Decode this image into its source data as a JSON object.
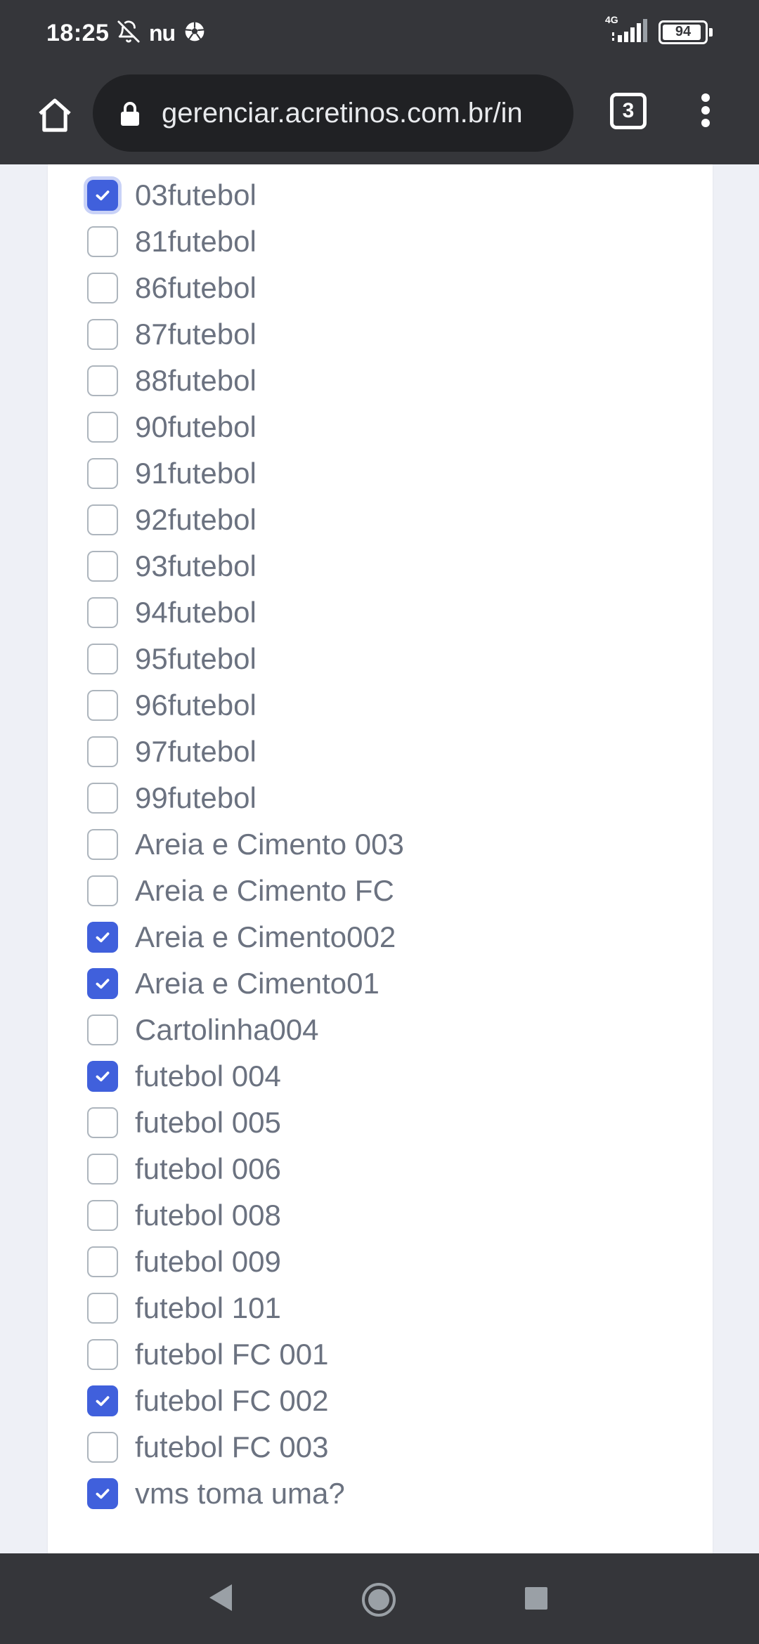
{
  "status_bar": {
    "time": "18:25",
    "notification_app": "nu",
    "network": "4G",
    "battery_percent": "94",
    "battery_level": 0.94,
    "icons": [
      "bell-off-icon",
      "soccer-ball-icon",
      "signal-icon",
      "battery-icon"
    ]
  },
  "browser": {
    "url": "gerenciar.acretinos.com.br/in",
    "tab_count": "3",
    "icons": [
      "home-icon",
      "lock-icon",
      "tab-switcher-icon",
      "more-vert-icon"
    ]
  },
  "options": [
    {
      "label": "03futebol",
      "checked": true,
      "focused": true
    },
    {
      "label": "81futebol",
      "checked": false
    },
    {
      "label": "86futebol",
      "checked": false
    },
    {
      "label": "87futebol",
      "checked": false
    },
    {
      "label": "88futebol",
      "checked": false
    },
    {
      "label": "90futebol",
      "checked": false
    },
    {
      "label": "91futebol",
      "checked": false
    },
    {
      "label": "92futebol",
      "checked": false
    },
    {
      "label": "93futebol",
      "checked": false
    },
    {
      "label": "94futebol",
      "checked": false
    },
    {
      "label": "95futebol",
      "checked": false
    },
    {
      "label": "96futebol",
      "checked": false
    },
    {
      "label": "97futebol",
      "checked": false
    },
    {
      "label": "99futebol",
      "checked": false
    },
    {
      "label": "Areia e Cimento 003",
      "checked": false
    },
    {
      "label": "Areia e Cimento FC",
      "checked": false
    },
    {
      "label": "Areia e Cimento002",
      "checked": true
    },
    {
      "label": "Areia e Cimento01",
      "checked": true
    },
    {
      "label": "Cartolinha004",
      "checked": false
    },
    {
      "label": "futebol 004",
      "checked": true
    },
    {
      "label": "futebol 005",
      "checked": false
    },
    {
      "label": "futebol 006",
      "checked": false
    },
    {
      "label": "futebol 008",
      "checked": false
    },
    {
      "label": "futebol 009",
      "checked": false
    },
    {
      "label": "futebol 101",
      "checked": false
    },
    {
      "label": "futebol FC 001",
      "checked": false
    },
    {
      "label": "futebol FC 002",
      "checked": true
    },
    {
      "label": "futebol FC 003",
      "checked": false
    },
    {
      "label": "vms toma uma?",
      "checked": true
    }
  ],
  "colors": {
    "accent": "#4060dc",
    "chrome_bar": "#35363a",
    "label_text": "#6b7280"
  },
  "nav_bar": {
    "icons": [
      "back-icon",
      "home-circle-icon",
      "recents-icon"
    ]
  }
}
